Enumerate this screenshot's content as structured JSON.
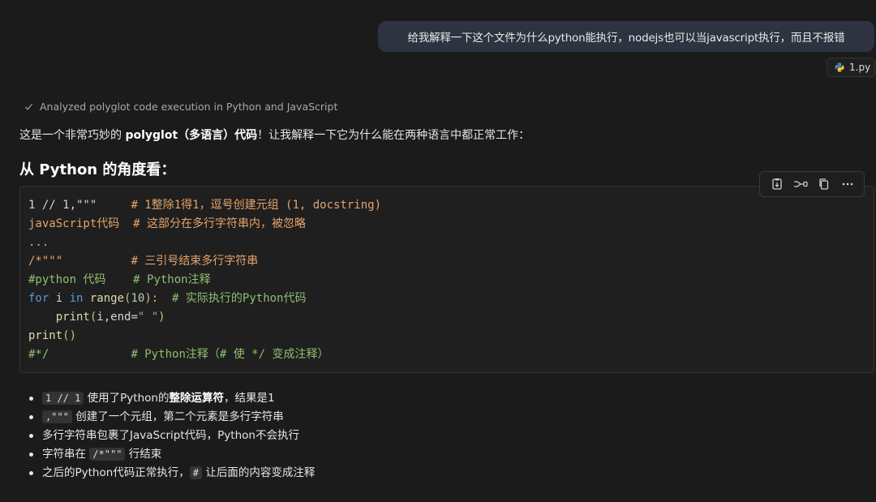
{
  "user_message": "给我解释一下这个文件为什么python能执行，nodejs也可以当javascript执行，而且不报错",
  "attachment": {
    "filename": "1.py",
    "icon": "python-icon"
  },
  "status_line": "Analyzed polyglot code execution in Python and JavaScript",
  "intro": {
    "prefix": "这是一个非常巧妙的 ",
    "bold": "polyglot（多语言）代码",
    "suffix": "！让我解释一下它为什么能在两种语言中都正常工作："
  },
  "heading": "从 Python 的角度看：",
  "code_toolbar": [
    "apply-icon",
    "branch-icon",
    "copy-icon",
    "more-icon"
  ],
  "code": {
    "line1_a": "1 // 1,\"\"\"",
    "line1_b": "     # 1整除1得1，逗号创建元组 (1, docstring)",
    "line2_a": "javaScript代码",
    "line2_b": "  # 这部分在多行字符串内，被忽略",
    "line3": "...",
    "line4_a": "/*\"\"\"",
    "line4_b": "          # 三引号结束多行字符串",
    "line5_a": "#python 代码",
    "line5_b": "    # Python注释",
    "line6_kw1": "for",
    "line6_var": " i ",
    "line6_kw2": "in",
    "line6_fn": " range",
    "line6_p1": "(",
    "line6_num": "10",
    "line6_p2": "):",
    "line6_comment": "  # 实际执行的Python代码",
    "line7_fn": "    print",
    "line7_p1": "(",
    "line7_args": "i,end=",
    "line7_str": "\" \"",
    "line7_p2": ")",
    "line8_fn": "print",
    "line8_p": "()",
    "line9_a": "#*/",
    "line9_b": "            # Python注释（# 使 */ 变成注释）"
  },
  "bullets": [
    {
      "code": "1 // 1",
      "text_a": " 使用了Python的",
      "bold": "整除运算符",
      "text_b": "，结果是1"
    },
    {
      "code": ",\"\"\"",
      "text_a": " 创建了一个元组，第二个元素是多行字符串"
    },
    {
      "text_a": "多行字符串包裹了JavaScript代码，Python不会执行"
    },
    {
      "text_a": "字符串在 ",
      "code": "/*\"\"\"",
      "text_b": " 行结束"
    },
    {
      "text_a": "之后的Python代码正常执行，",
      "code": "#",
      "text_b": " 让后面的内容变成注释"
    }
  ]
}
